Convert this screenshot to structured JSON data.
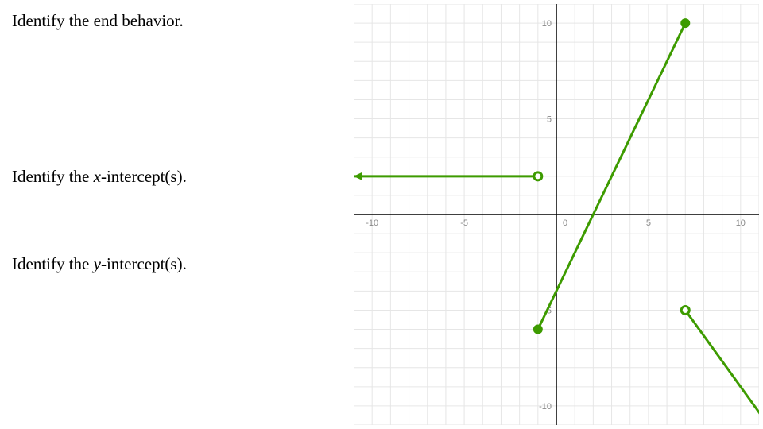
{
  "prompts": {
    "end_behavior": "Identify the end behavior.",
    "x_intercepts_pre": "Identify the ",
    "x_intercepts_var": "x",
    "x_intercepts_post": "-intercept(s).",
    "y_intercepts_pre": "Identify the ",
    "y_intercepts_var": "y",
    "y_intercepts_post": "-intercept(s)."
  },
  "chart_data": {
    "type": "line",
    "title": "",
    "xlabel": "",
    "ylabel": "",
    "xlim": [
      -11,
      11
    ],
    "ylim": [
      -11,
      11
    ],
    "xticks": [
      -10,
      -5,
      0,
      5,
      10
    ],
    "yticks": [
      -10,
      -5,
      5,
      10
    ],
    "grid": true,
    "segments": [
      {
        "name": "left-ray",
        "points": [
          [
            -11,
            2
          ],
          [
            -1,
            2
          ]
        ],
        "left_arrow": true,
        "right_endpoint": {
          "x": -1,
          "y": 2,
          "open": true
        }
      },
      {
        "name": "middle-segment",
        "points": [
          [
            -1,
            -6
          ],
          [
            7,
            10
          ]
        ],
        "left_endpoint": {
          "x": -1,
          "y": -6,
          "open": false
        },
        "right_endpoint": {
          "x": 7,
          "y": 10,
          "open": false
        }
      },
      {
        "name": "right-ray",
        "points": [
          [
            7,
            -5
          ],
          [
            11.5,
            -11
          ]
        ],
        "left_endpoint": {
          "x": 7,
          "y": -5,
          "open": true
        },
        "right_arrow": true
      }
    ],
    "colors": {
      "graph": "#3d9b00",
      "grid": "#e6e6e6",
      "axis": "#000000",
      "tick_text": "#888888"
    }
  }
}
